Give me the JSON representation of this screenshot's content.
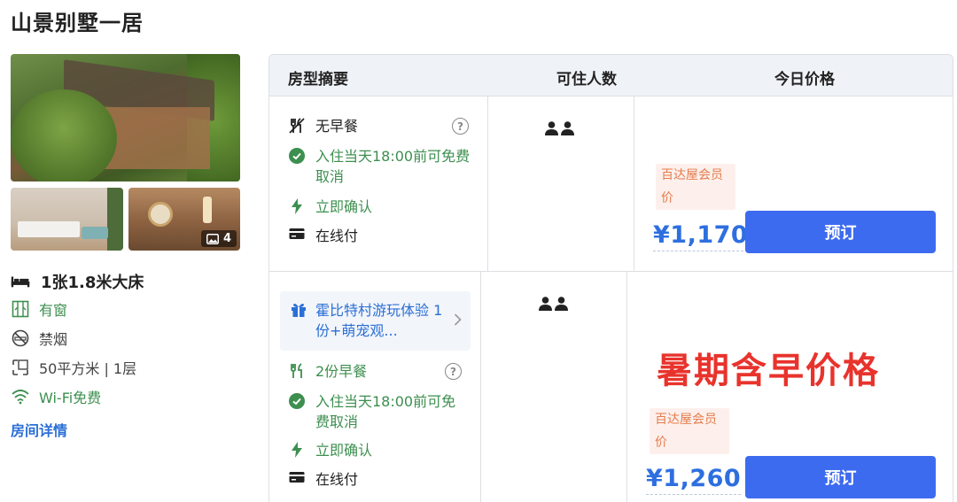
{
  "page": {
    "title": "山景别墅一居"
  },
  "gallery": {
    "photo_count": "4"
  },
  "room": {
    "bed": "1张1.8米大床",
    "window": "有窗",
    "smoking": "禁烟",
    "area_floor": "50平方米 | 1层",
    "wifi": "Wi-Fi免费",
    "details_link": "房间详情"
  },
  "table": {
    "headers": {
      "summary": "房型摘要",
      "occupancy": "可住人数",
      "price": "今日价格"
    }
  },
  "rates": [
    {
      "meal": "无早餐",
      "cancel": "入住当天18:00前可免费取消",
      "confirm": "立即确认",
      "payment": "在线付",
      "member_label": "百达屋会员价",
      "price": "¥1,170",
      "book_label": "预订"
    },
    {
      "package": "霍比特村游玩体验 1份+萌宠观...",
      "meal": "2份早餐",
      "cancel": "入住当天18:00前可免费取消",
      "confirm": "立即确认",
      "payment": "在线付",
      "member_label": "百达屋会员价",
      "price": "¥1,260",
      "book_label": "预订"
    }
  ],
  "annotation": {
    "text": "暑期含早价格"
  },
  "colors": {
    "accent_blue": "#3d6bf0",
    "price_blue": "#2e6fe0",
    "policy_green": "#3d8f4f",
    "member_orange": "#e57c4c",
    "annotation_red": "#e8332c"
  }
}
